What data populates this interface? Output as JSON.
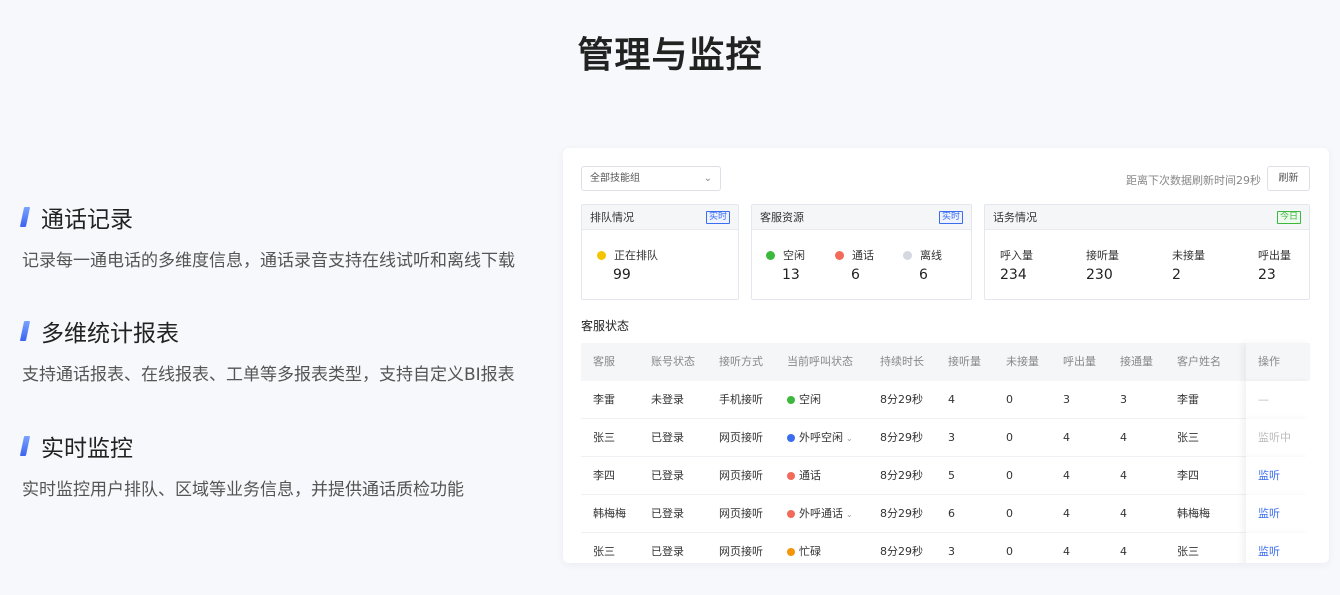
{
  "page": {
    "title": "管理与监控"
  },
  "features": [
    {
      "title": "通话记录",
      "desc": "记录每一通电话的多维度信息，通话录音支持在线试听和离线下载"
    },
    {
      "title": "多维统计报表",
      "desc": "支持通话报表、在线报表、工单等多报表类型，支持自定义BI报表"
    },
    {
      "title": "实时监控",
      "desc": "实时监控用户排队、区域等业务信息，并提供通话质检功能"
    }
  ],
  "dashboard": {
    "skill_group_select": "全部技能组",
    "refresh_note": "距离下次数据刷新时间29秒",
    "refresh_button": "刷新",
    "cards": {
      "queue": {
        "title": "排队情况",
        "tag": "实时",
        "stats": [
          {
            "label": "正在排队",
            "value": "99"
          }
        ]
      },
      "resources": {
        "title": "客服资源",
        "tag": "实时",
        "stats": [
          {
            "label": "空闲",
            "value": "13"
          },
          {
            "label": "通话",
            "value": "6"
          },
          {
            "label": "离线",
            "value": "6"
          }
        ]
      },
      "traffic": {
        "title": "话务情况",
        "tag": "今日",
        "stats": [
          {
            "label": "呼入量",
            "value": "234"
          },
          {
            "label": "接听量",
            "value": "230"
          },
          {
            "label": "未接量",
            "value": "2"
          },
          {
            "label": "呼出量",
            "value": "23"
          }
        ]
      }
    },
    "colors": {
      "queue": "#f5c400",
      "idle": "#3cb83c",
      "talking": "#f26a5a",
      "offline": "#d5d8e0",
      "outbound_idle": "#3b6df0",
      "busy": "#f5950a",
      "accent": "#3b6df0"
    },
    "agent_status": {
      "title": "客服状态",
      "columns": [
        "客服",
        "账号状态",
        "接听方式",
        "当前呼叫状态",
        "持续时长",
        "接听量",
        "未接量",
        "呼出量",
        "接通量",
        "客户姓名",
        "操作"
      ],
      "rows": [
        {
          "agent": "李雷",
          "account": "未登录",
          "method": "手机接听",
          "call_status": "空闲",
          "status_color": "#3cb83c",
          "dropdown": false,
          "duration": "8分29秒",
          "answered": "4",
          "missed": "0",
          "outbound": "3",
          "connected": "3",
          "customer": "李雷",
          "action": "—",
          "action_type": "muted"
        },
        {
          "agent": "张三",
          "account": "已登录",
          "method": "网页接听",
          "call_status": "外呼空闲",
          "status_color": "#3b6df0",
          "dropdown": true,
          "duration": "8分29秒",
          "answered": "3",
          "missed": "0",
          "outbound": "4",
          "connected": "4",
          "customer": "张三",
          "action": "监听中",
          "action_type": "muted"
        },
        {
          "agent": "李四",
          "account": "已登录",
          "method": "网页接听",
          "call_status": "通话",
          "status_color": "#f26a5a",
          "dropdown": false,
          "duration": "8分29秒",
          "answered": "5",
          "missed": "0",
          "outbound": "4",
          "connected": "4",
          "customer": "李四",
          "action": "监听",
          "action_type": "link"
        },
        {
          "agent": "韩梅梅",
          "account": "已登录",
          "method": "网页接听",
          "call_status": "外呼通话",
          "status_color": "#f26a5a",
          "dropdown": true,
          "duration": "8分29秒",
          "answered": "6",
          "missed": "0",
          "outbound": "4",
          "connected": "4",
          "customer": "韩梅梅",
          "action": "监听",
          "action_type": "link"
        },
        {
          "agent": "张三",
          "account": "已登录",
          "method": "网页接听",
          "call_status": "忙碌",
          "status_color": "#f5950a",
          "dropdown": false,
          "duration": "8分29秒",
          "answered": "3",
          "missed": "0",
          "outbound": "4",
          "connected": "4",
          "customer": "张三",
          "action": "监听",
          "action_type": "link"
        }
      ]
    }
  }
}
